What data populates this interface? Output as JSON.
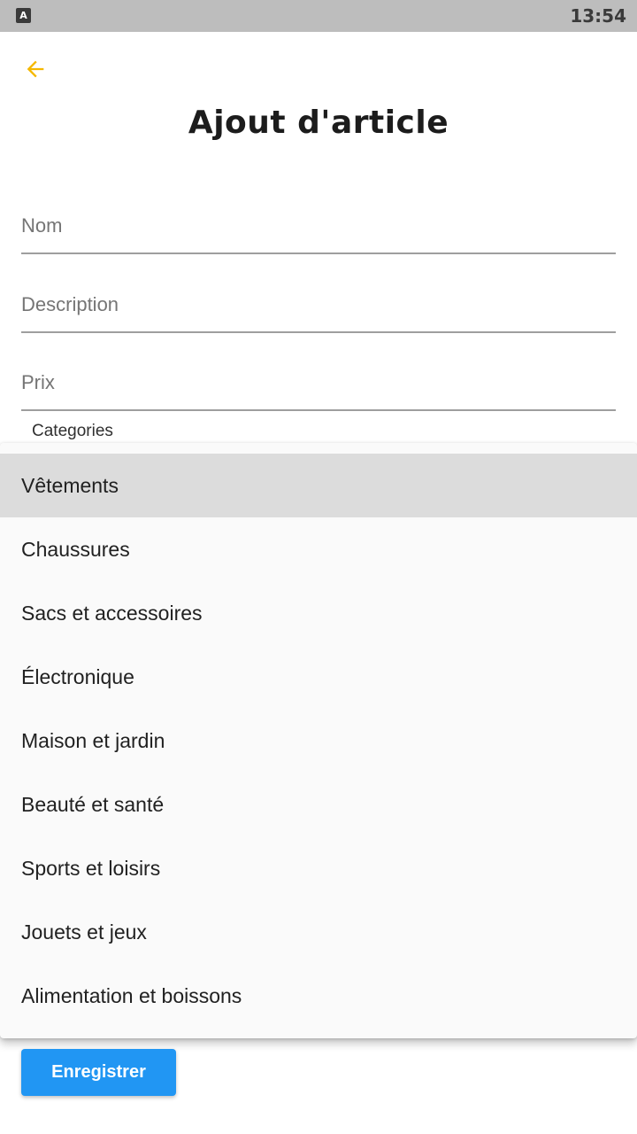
{
  "status_bar": {
    "app_icon_letter": "A",
    "time": "13:54"
  },
  "header": {
    "back_icon": "arrow-left-icon",
    "title": "Ajout d'article"
  },
  "form": {
    "nom_placeholder": "Nom",
    "description_placeholder": "Description",
    "prix_placeholder": "Prix",
    "categories_label": "Categories"
  },
  "dropdown": {
    "selected": "Vêtements",
    "items": [
      {
        "label": "Vêtements"
      },
      {
        "label": "Chaussures"
      },
      {
        "label": "Sacs et accessoires"
      },
      {
        "label": "Électronique"
      },
      {
        "label": "Maison et jardin"
      },
      {
        "label": "Beauté et santé"
      },
      {
        "label": "Sports et loisirs"
      },
      {
        "label": "Jouets et jeux"
      },
      {
        "label": "Alimentation et boissons"
      }
    ]
  },
  "actions": {
    "save_label": "Enregistrer"
  },
  "colors": {
    "accent": "#f5b800",
    "primary_button": "#2196f3",
    "status_bar": "#bdbdbd",
    "selected_item": "#dcdcdc"
  }
}
